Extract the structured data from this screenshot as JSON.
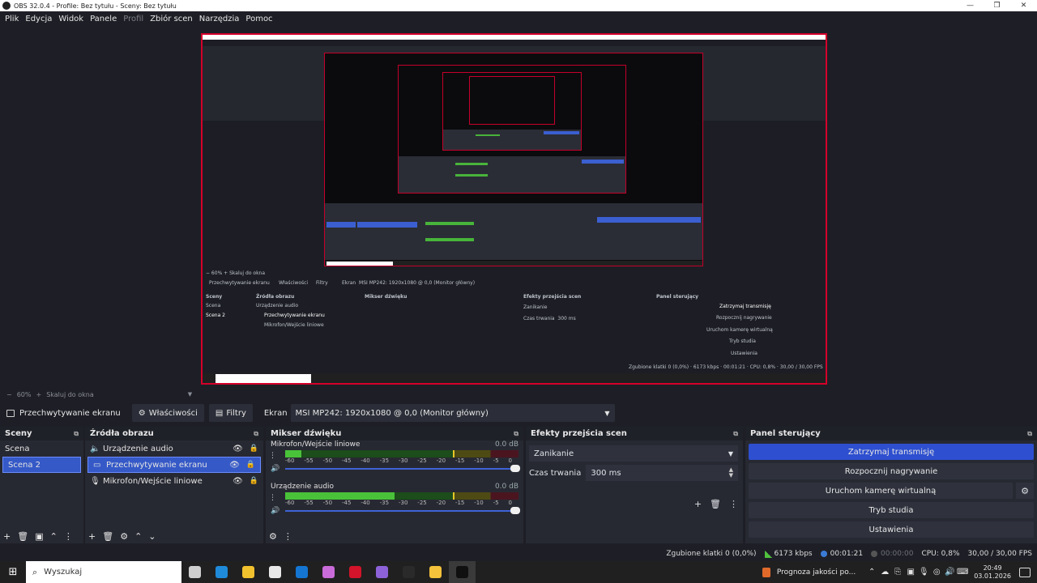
{
  "window": {
    "title": "OBS 32.0.4 - Profile: Bez tytułu - Sceny: Bez tytułu",
    "controls": [
      "—",
      "❐",
      "✕"
    ]
  },
  "menu": [
    "Plik",
    "Edycja",
    "Widok",
    "Panele",
    "Profil",
    "Zbiór scen",
    "Narzędzia",
    "Pomoc"
  ],
  "zoom": {
    "minus": "−",
    "value": "60%",
    "plus": "+",
    "fit": "Skaluj do okna"
  },
  "context_bar": {
    "source_label": "Przechwytywanie ekranu",
    "properties": "Właściwości",
    "filters": "Filtry",
    "screen_label": "Ekran",
    "screen_value": "MSI MP242: 1920x1080 @ 0,0 (Monitor główny)"
  },
  "scenes": {
    "title": "Sceny",
    "items": [
      "Scena",
      "Scena 2"
    ],
    "selected": 1
  },
  "sources": {
    "title": "Źródła obrazu",
    "items": [
      {
        "icon": "speaker-icon",
        "glyph": "🔊",
        "label": "Urządzenie audio"
      },
      {
        "icon": "monitor-icon",
        "glyph": "▭",
        "label": "Przechwytywanie ekranu"
      },
      {
        "icon": "microphone-icon",
        "glyph": "🎤",
        "label": "Mikrofon/Wejście liniowe"
      }
    ],
    "selected": 1
  },
  "mixer": {
    "title": "Mikser dźwięku",
    "channels": [
      {
        "name": "Mikrofon/Wejście liniowe",
        "db": "0.0 dB",
        "level": 0.07,
        "peak": 0.72
      },
      {
        "name": "Urządzenie audio",
        "db": "0.0 dB",
        "level": 0.47,
        "peak": 0.72
      }
    ],
    "ticks": [
      "-60",
      "-55",
      "-50",
      "-45",
      "-40",
      "-35",
      "-30",
      "-25",
      "-20",
      "-15",
      "-10",
      "-5",
      "0"
    ]
  },
  "transitions": {
    "title": "Efekty przejścia scen",
    "selected": "Zanikanie",
    "duration_label": "Czas trwania",
    "duration_value": "300 ms"
  },
  "controls": {
    "title": "Panel sterujący",
    "stop_stream": "Zatrzymaj transmisję",
    "start_record": "Rozpocznij nagrywanie",
    "virtual_cam": "Uruchom kamerę wirtualną",
    "studio_mode": "Tryb studia",
    "settings": "Ustawienia"
  },
  "status": {
    "dropped": "Zgubione klatki 0 (0,0%)",
    "bitrate": "6173 kbps",
    "stream_time": "00:01:21",
    "rec_time": "00:00:00",
    "cpu": "CPU: 0,8%",
    "fps": "30,00 / 30,00 FPS"
  },
  "taskbar": {
    "search_placeholder": "Wyszukaj",
    "weather": "Prognoza jakości po...",
    "time": "20:49",
    "date": "03.01.2026",
    "apps": [
      {
        "name": "task-view",
        "color": "#cfcfcf"
      },
      {
        "name": "edge",
        "color": "#1f8ad8"
      },
      {
        "name": "file-explorer",
        "color": "#f2c12e"
      },
      {
        "name": "store",
        "color": "#e8e8e8"
      },
      {
        "name": "outlook",
        "color": "#1476d1"
      },
      {
        "name": "copilot",
        "color": "#c96bd8"
      },
      {
        "name": "opera",
        "color": "#d4142a"
      },
      {
        "name": "discord",
        "color": "#8d62d8"
      },
      {
        "name": "capcut",
        "color": "#2a2a2a"
      },
      {
        "name": "notes",
        "color": "#f4c23b"
      },
      {
        "name": "obs",
        "color": "#101010"
      }
    ]
  },
  "colors": {
    "accent": "#2e4fcf",
    "selection": "#3559c7",
    "preview_border": "#d4002a",
    "meter_green": "#49c23a"
  }
}
